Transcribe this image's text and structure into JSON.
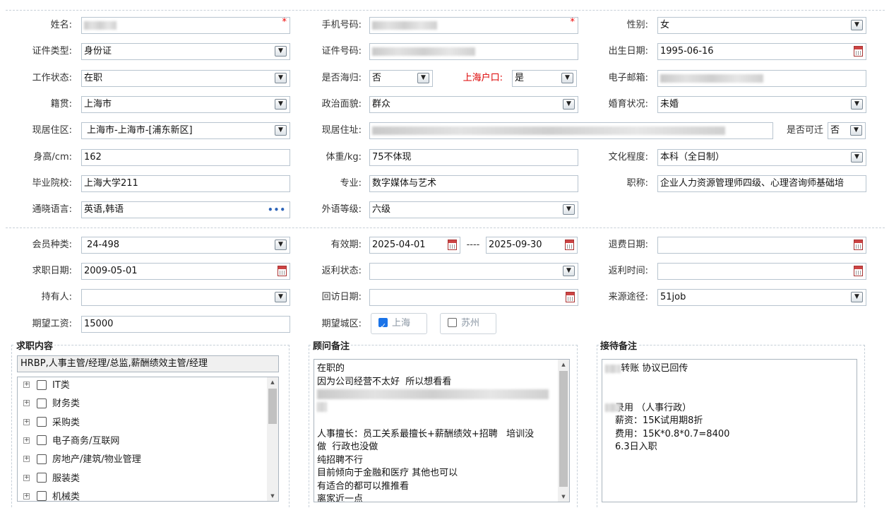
{
  "basic": {
    "name_label": "姓名:",
    "name_value": "",
    "mobile_label": "手机号码:",
    "mobile_value": "",
    "gender_label": "性别:",
    "gender_value": "女",
    "idtype_label": "证件类型:",
    "idtype_value": "身份证",
    "idno_label": "证件号码:",
    "idno_value": "",
    "birth_label": "出生日期:",
    "birth_value": "1995-06-16",
    "work_label": "工作状态:",
    "work_value": "在职",
    "overseas_label": "是否海归:",
    "overseas_value": "否",
    "hukou_label": "上海户口:",
    "hukou_value": "是",
    "email_label": "电子邮箱:",
    "email_value": "",
    "native_label": "籍贯:",
    "native_value": "上海市",
    "political_label": "政治面貌:",
    "political_value": "群众",
    "marital_label": "婚育状况:",
    "marital_value": "未婚",
    "district_label": "现居住区:",
    "district_value": "上海市-上海市-[浦东新区]",
    "address_label": "现居住址:",
    "address_value": "",
    "relocate_label": "是否可迁",
    "relocate_value": "否",
    "height_label": "身高/cm:",
    "height_value": "162",
    "weight_label": "体重/kg:",
    "weight_value": "75不体现",
    "edu_label": "文化程度:",
    "edu_value": "本科（全日制）",
    "school_label": "毕业院校:",
    "school_value": "上海大学211",
    "major_label": "专业:",
    "major_value": "数字媒体与艺术",
    "title_label": "职称:",
    "title_value": "企业人力资源管理师四级、心理咨询师基础培",
    "lang_label": "通晓语言:",
    "lang_value": "英语,韩语",
    "lang_more": "•••",
    "foreign_label": "外语等级:",
    "foreign_value": "六级"
  },
  "member": {
    "type_label": "会员种类:",
    "type_value": "24-498",
    "valid_label": "有效期:",
    "valid_from": "2025-04-01",
    "valid_dash": "----",
    "valid_to": "2025-09-30",
    "refund_label": "退费日期:",
    "refund_value": "",
    "jobdate_label": "求职日期:",
    "jobdate_value": "2009-05-01",
    "rebate_label": "返利状态:",
    "rebate_value": "",
    "rebatetime_label": "返利时间:",
    "rebatetime_value": "",
    "holder_label": "持有人:",
    "holder_value": "",
    "revisit_label": "回访日期:",
    "revisit_value": "",
    "source_label": "来源途径:",
    "source_value": "51job",
    "salary_label": "期望工资:",
    "salary_value": "15000",
    "city_label": "期望城区:",
    "cities": [
      {
        "label": "上海",
        "checked": true
      },
      {
        "label": "苏州",
        "checked": false
      }
    ]
  },
  "job_panel": {
    "legend": "求职内容",
    "summary": "HRBP,人事主管/经理/总监,薪酬绩效主管/经理",
    "categories": [
      "IT类",
      "财务类",
      "采购类",
      "电子商务/互联网",
      "房地产/建筑/物业管理",
      "服装类",
      "机械类"
    ]
  },
  "consultant_panel": {
    "legend": "顾问备注",
    "lines": [
      "在职的",
      "因为公司经营不太好  所以想看看",
      "",
      "",
      "",
      "人事擅长：员工关系最擅长+薪酬绩效+招聘   培训没",
      "做  行政也没做",
      "纯招聘不行",
      "目前倾向于金融和医疗 其他也可以",
      "有适合的都可以推推看",
      "离家近一点"
    ]
  },
  "reception_panel": {
    "legend": "接待备注",
    "lines": [
      "  转账 协议已回传",
      "",
      "",
      "录用 （人事行政）",
      "薪资：15K试用期8折",
      "费用：15K*0.8*0.7=8400",
      "6.3日入职"
    ]
  },
  "icons": {
    "dropdown": "▼",
    "tree_expand": "+",
    "scroll_up": "▲",
    "scroll_down": "▼"
  }
}
